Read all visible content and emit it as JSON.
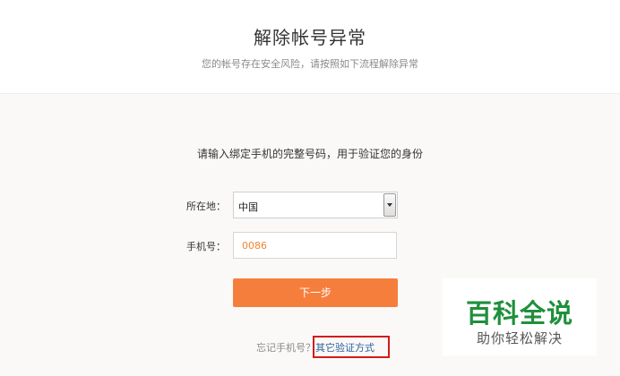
{
  "header": {
    "title": "解除帐号异常",
    "subtitle": "您的帐号存在安全风险，请按照如下流程解除异常"
  },
  "form": {
    "instruction": "请输入绑定手机的完整号码，用于验证您的身份",
    "region_label": "所在地：",
    "region_value": "中国",
    "phone_label": "手机号：",
    "phone_value": "0086",
    "next_button": "下一步"
  },
  "footer": {
    "forgot_text": "忘记手机号？",
    "other_methods_link": "其它验证方式"
  },
  "watermark": {
    "title": "百科全说",
    "subtitle": "助你轻松解决"
  },
  "colors": {
    "accent": "#f67e3c",
    "link": "#2d5f9a",
    "highlight": "#d11c1c",
    "watermark_green": "#1f8f3c"
  }
}
